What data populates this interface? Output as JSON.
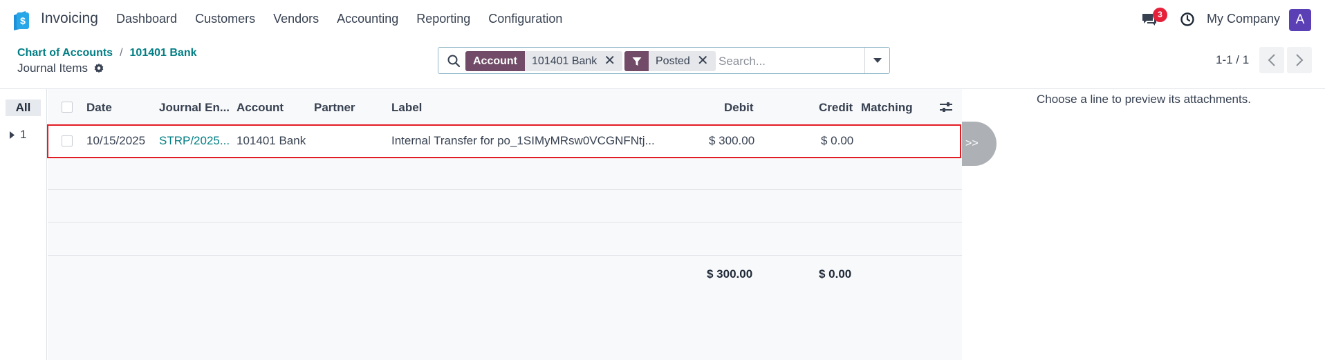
{
  "app": {
    "name": "Invoicing",
    "logo_icon": "invoicing-app-icon"
  },
  "menu": [
    "Dashboard",
    "Customers",
    "Vendors",
    "Accounting",
    "Reporting",
    "Configuration"
  ],
  "nav": {
    "messages_badge": "3",
    "company": "My Company",
    "avatar_initial": "A"
  },
  "breadcrumb": {
    "parent": "Chart of Accounts",
    "separator": "/",
    "current": "101401 Bank"
  },
  "page_title": "Journal Items",
  "search": {
    "facets": [
      {
        "label": "Account",
        "value": "101401 Bank"
      },
      {
        "icon": "filter-icon",
        "value": "Posted"
      }
    ],
    "placeholder": "Search..."
  },
  "pager": {
    "text": "1-1 / 1"
  },
  "groups": {
    "all_label": "All",
    "group_label": "1"
  },
  "table": {
    "columns": [
      "Date",
      "Journal En...",
      "Account",
      "Partner",
      "Label",
      "Debit",
      "Credit",
      "Matching"
    ],
    "rows": [
      {
        "date": "10/15/2025",
        "journal_entry": "STRP/2025...",
        "account": "101401 Bank",
        "partner": "",
        "label": "Internal Transfer for po_1SIMyMRsw0VCGNFNtj...",
        "debit": "$ 300.00",
        "credit": "$ 0.00",
        "matching": ""
      }
    ],
    "totals": {
      "debit": "$ 300.00",
      "credit": "$ 0.00"
    }
  },
  "expand_button": ">>",
  "preview": {
    "empty_text": "Choose a line to preview its attachments."
  },
  "colors": {
    "brand": "#714b67",
    "link": "#017e84",
    "highlight": "#e31b23",
    "badge": "#e5213a",
    "avatar": "#5b3fb5"
  }
}
